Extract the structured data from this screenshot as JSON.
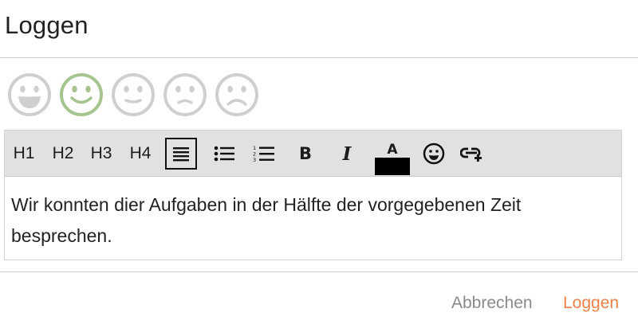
{
  "dialog": {
    "title": "Loggen"
  },
  "moods": {
    "options": [
      {
        "name": "very-happy-icon",
        "selected": false
      },
      {
        "name": "happy-icon",
        "selected": true
      },
      {
        "name": "neutral-icon",
        "selected": false
      },
      {
        "name": "slightly-sad-icon",
        "selected": false
      },
      {
        "name": "sad-icon",
        "selected": false
      }
    ],
    "colors": {
      "default": "#cfcfcf",
      "selected": "#a6c48d"
    }
  },
  "toolbar": {
    "h1": "H1",
    "h2": "H2",
    "h3": "H3",
    "h4": "H4",
    "bold": "B",
    "italic": "I",
    "font_color_letter": "A",
    "font_color_value": "#000000",
    "icons": [
      "align-justify-icon",
      "bullet-list-icon",
      "numbered-list-icon",
      "bold-icon",
      "italic-icon",
      "font-color-icon",
      "emoji-icon",
      "insert-link-icon"
    ]
  },
  "editor": {
    "text": "Wir konnten dier Aufgaben in der Hälfte der vorgegebenen Zeit besprechen."
  },
  "actions": {
    "cancel_label": "Abbrechen",
    "confirm_label": "Loggen"
  }
}
